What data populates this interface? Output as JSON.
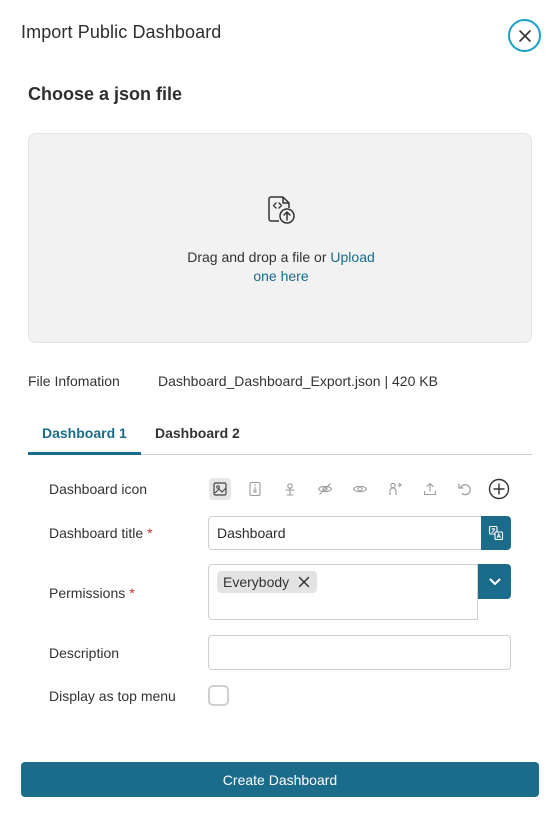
{
  "dialog": {
    "title": "Import Public Dashboard",
    "close_icon": "close-icon"
  },
  "upload": {
    "section_title": "Choose a json file",
    "icon": "file-code-upload-icon",
    "prompt_text": "Drag and drop a file or",
    "link_first": "Upload",
    "link_second": "one here"
  },
  "file_info": {
    "label": "File Infomation",
    "value": "Dashboard_Dashboard_Export.json | 420 KB"
  },
  "tabs": [
    {
      "label": "Dashboard 1",
      "active": true
    },
    {
      "label": "Dashboard 2",
      "active": false
    }
  ],
  "form": {
    "icon_label": "Dashboard icon",
    "icon_tools": [
      "image-icon",
      "file-zip-icon",
      "tree-icon",
      "eye-off-icon",
      "eye-icon",
      "user-share-icon",
      "upload-icon",
      "undo-icon",
      "add-circle-icon"
    ],
    "title_label": "Dashboard title",
    "required_mark": "*",
    "title_value": "Dashboard",
    "translate_icon": "translate-icon",
    "permissions_label": "Permissions",
    "permission_chips": [
      "Everybody"
    ],
    "permissions_dropdown_icon": "chevron-down-icon",
    "description_label": "Description",
    "description_value": "",
    "top_menu_label": "Display as top menu",
    "top_menu_checked": false
  },
  "actions": {
    "create_label": "Create Dashboard"
  },
  "colors": {
    "accent": "#1b6b8a",
    "close_ring": "#15a2c9",
    "required": "#d32f2f"
  }
}
